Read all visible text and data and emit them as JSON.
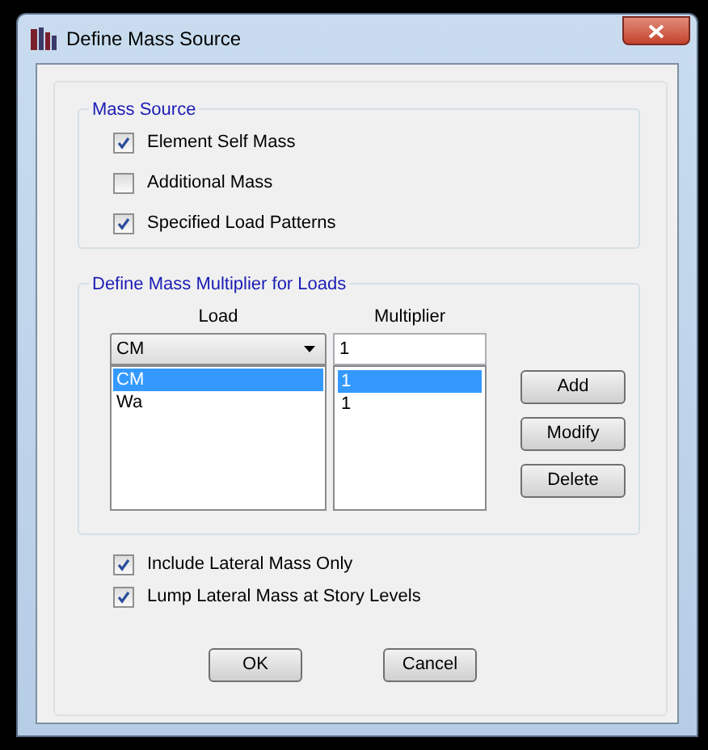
{
  "window": {
    "title": "Define Mass Source"
  },
  "mass_source": {
    "title": "Mass Source",
    "options": [
      {
        "label": "Element Self Mass",
        "checked": true
      },
      {
        "label": "Additional Mass",
        "checked": false
      },
      {
        "label": "Specified Load Patterns",
        "checked": true
      }
    ]
  },
  "multiplier_group": {
    "title": "Define Mass Multiplier for Loads",
    "load_header": "Load",
    "multiplier_header": "Multiplier",
    "load_select": "CM",
    "multiplier_value": "1",
    "rows": [
      {
        "load": "CM",
        "multiplier": "1",
        "selected": true
      },
      {
        "load": "Wa",
        "multiplier": "1",
        "selected": false
      }
    ],
    "buttons": [
      "Add",
      "Modify",
      "Delete"
    ]
  },
  "options": [
    {
      "label": "Include Lateral Mass Only",
      "checked": true
    },
    {
      "label": "Lump Lateral Mass at Story Levels",
      "checked": true
    }
  ],
  "buttons": [
    "OK",
    "Cancel"
  ]
}
